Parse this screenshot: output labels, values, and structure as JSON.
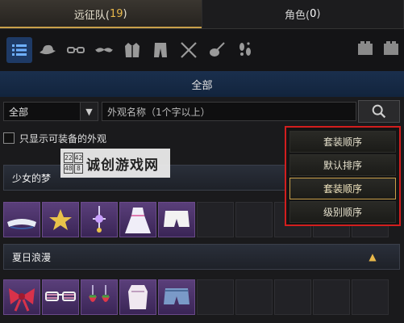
{
  "tabs": [
    {
      "label": "远征队(",
      "count": "19",
      "suffix": ")",
      "active": true
    },
    {
      "label": "角色(",
      "count": "0",
      "suffix": ")",
      "active": false
    }
  ],
  "icon_bar": {
    "icons": [
      "list-icon",
      "hat-icon",
      "glasses-icon",
      "mustache-icon",
      "jacket-icon",
      "pants-icon",
      "weapons-icon",
      "instrument-icon",
      "footprints-icon"
    ],
    "right_icons": [
      "outfit-set-1-icon",
      "outfit-set-2-icon"
    ]
  },
  "category_header": "全部",
  "filter": {
    "select_value": "全部",
    "search_placeholder": "外观名称（1个字以上）"
  },
  "checkbox_label": "只显示可装备的外观",
  "sections": [
    {
      "title": "少女的梦",
      "items": [
        "sailor-hat",
        "star",
        "bell-ornament",
        "dress",
        "white-shorts"
      ]
    },
    {
      "title": "夏日浪漫",
      "items": [
        "red-bow",
        "striped-glasses",
        "strawberry-earrings",
        "lace-top",
        "denim-shorts"
      ]
    }
  ],
  "sort_menu": {
    "items": [
      "套装顺序",
      "默认排序",
      "套装顺序",
      "级别顺序"
    ],
    "highlighted_index": 2
  },
  "watermark": {
    "logo_glyphs": [
      "22",
      "42",
      "48",
      "8"
    ],
    "text": "诚创游戏网"
  },
  "colors": {
    "accent_gold": "#e8b84a",
    "highlight_red": "#d21e1e",
    "selected_blue": "#1e3a66",
    "item_purple": "#4a3068"
  }
}
